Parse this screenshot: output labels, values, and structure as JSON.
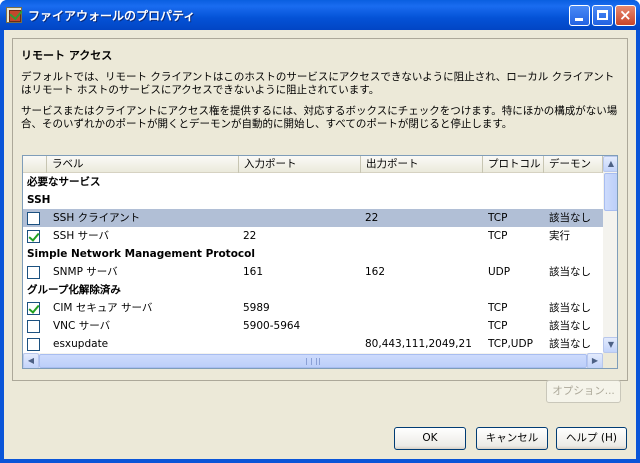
{
  "window": {
    "title": "ファイアウォールのプロパティ",
    "controls": {
      "minimize": "minimize",
      "maximize": "maximize",
      "close": "×"
    }
  },
  "section": {
    "heading": "リモート アクセス",
    "para1": "デフォルトでは、リモート クライアントはこのホストのサービスにアクセスできないように阻止され、ローカル クライアントはリモート ホストのサービスにアクセスできないように阻止されています。",
    "para2": "サービスまたはクライアントにアクセス権を提供するには、対応するボックスにチェックをつけます。特にほかの構成がない場合、そのいずれかのポートが開くとデーモンが自動的に開始し、すべてのポートが閉じると停止します。"
  },
  "table": {
    "columns": [
      "ラベル",
      "入力ポート",
      "出力ポート",
      "プロトコル",
      "デーモン"
    ],
    "rows": [
      {
        "type": "group",
        "label": "必要なサービス"
      },
      {
        "type": "group",
        "label": "SSH"
      },
      {
        "type": "item",
        "checked": false,
        "selected": true,
        "label": "SSH クライアント",
        "in": "",
        "out": "22",
        "protocol": "TCP",
        "daemon": "該当なし"
      },
      {
        "type": "item",
        "checked": true,
        "selected": false,
        "label": "SSH サーバ",
        "in": "22",
        "out": "",
        "protocol": "TCP",
        "daemon": "実行"
      },
      {
        "type": "group",
        "label": "Simple Network Management Protocol"
      },
      {
        "type": "item",
        "checked": false,
        "selected": false,
        "label": "SNMP サーバ",
        "in": "161",
        "out": "162",
        "protocol": "UDP",
        "daemon": "該当なし"
      },
      {
        "type": "group",
        "label": "グループ化解除済み"
      },
      {
        "type": "item",
        "checked": true,
        "selected": false,
        "label": "CIM セキュア サーバ",
        "in": "5989",
        "out": "",
        "protocol": "TCP",
        "daemon": "該当なし"
      },
      {
        "type": "item",
        "checked": false,
        "selected": false,
        "label": "VNC サーバ",
        "in": "5900-5964",
        "out": "",
        "protocol": "TCP",
        "daemon": "該当なし"
      },
      {
        "type": "item",
        "checked": false,
        "selected": false,
        "label": "esxupdate",
        "in": "",
        "out": "80,443,111,2049,21",
        "protocol": "TCP,UDP",
        "daemon": "該当なし"
      }
    ],
    "scroll": {
      "up": "▲",
      "down": "▼",
      "left": "◀",
      "right": "▶"
    }
  },
  "buttons": {
    "options": "オプション...",
    "ok": "OK",
    "cancel": "キャンセル",
    "help": "ヘルプ (H)"
  }
}
